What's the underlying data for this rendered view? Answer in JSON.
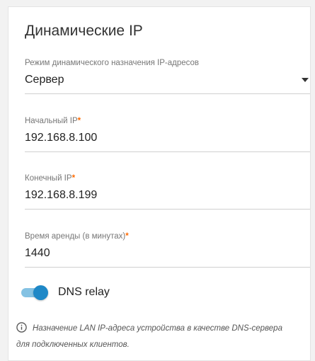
{
  "section": {
    "title": "Динамические IP"
  },
  "mode": {
    "label": "Режим динамического назначения IP-адресов",
    "value": "Сервер"
  },
  "start_ip": {
    "label": "Начальный IP",
    "required_mark": "*",
    "value": "192.168.8.100"
  },
  "end_ip": {
    "label": "Конечный IP",
    "required_mark": "*",
    "value": "192.168.8.199"
  },
  "lease": {
    "label": "Время аренды (в минутах)",
    "required_mark": "*",
    "value": "1440"
  },
  "dns_relay": {
    "label": "DNS relay",
    "enabled": true
  },
  "info": {
    "icon": "info-icon",
    "text": "Назначение LAN IP-адреса устройства в качестве DNS-сервера для подключенных клиентов."
  },
  "colors": {
    "accent": "#1e88c7",
    "required": "#ff6a00"
  }
}
